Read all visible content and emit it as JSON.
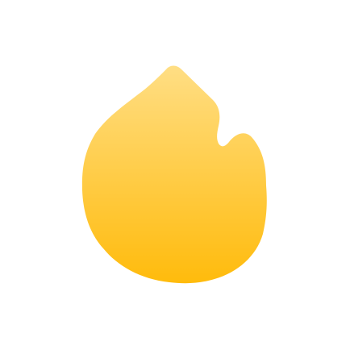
{
  "icon": {
    "name": "flame-icon",
    "colors": {
      "gradient_top": "#ffde84",
      "gradient_bottom": "#ffbb0c",
      "background": "#ffffff"
    }
  }
}
